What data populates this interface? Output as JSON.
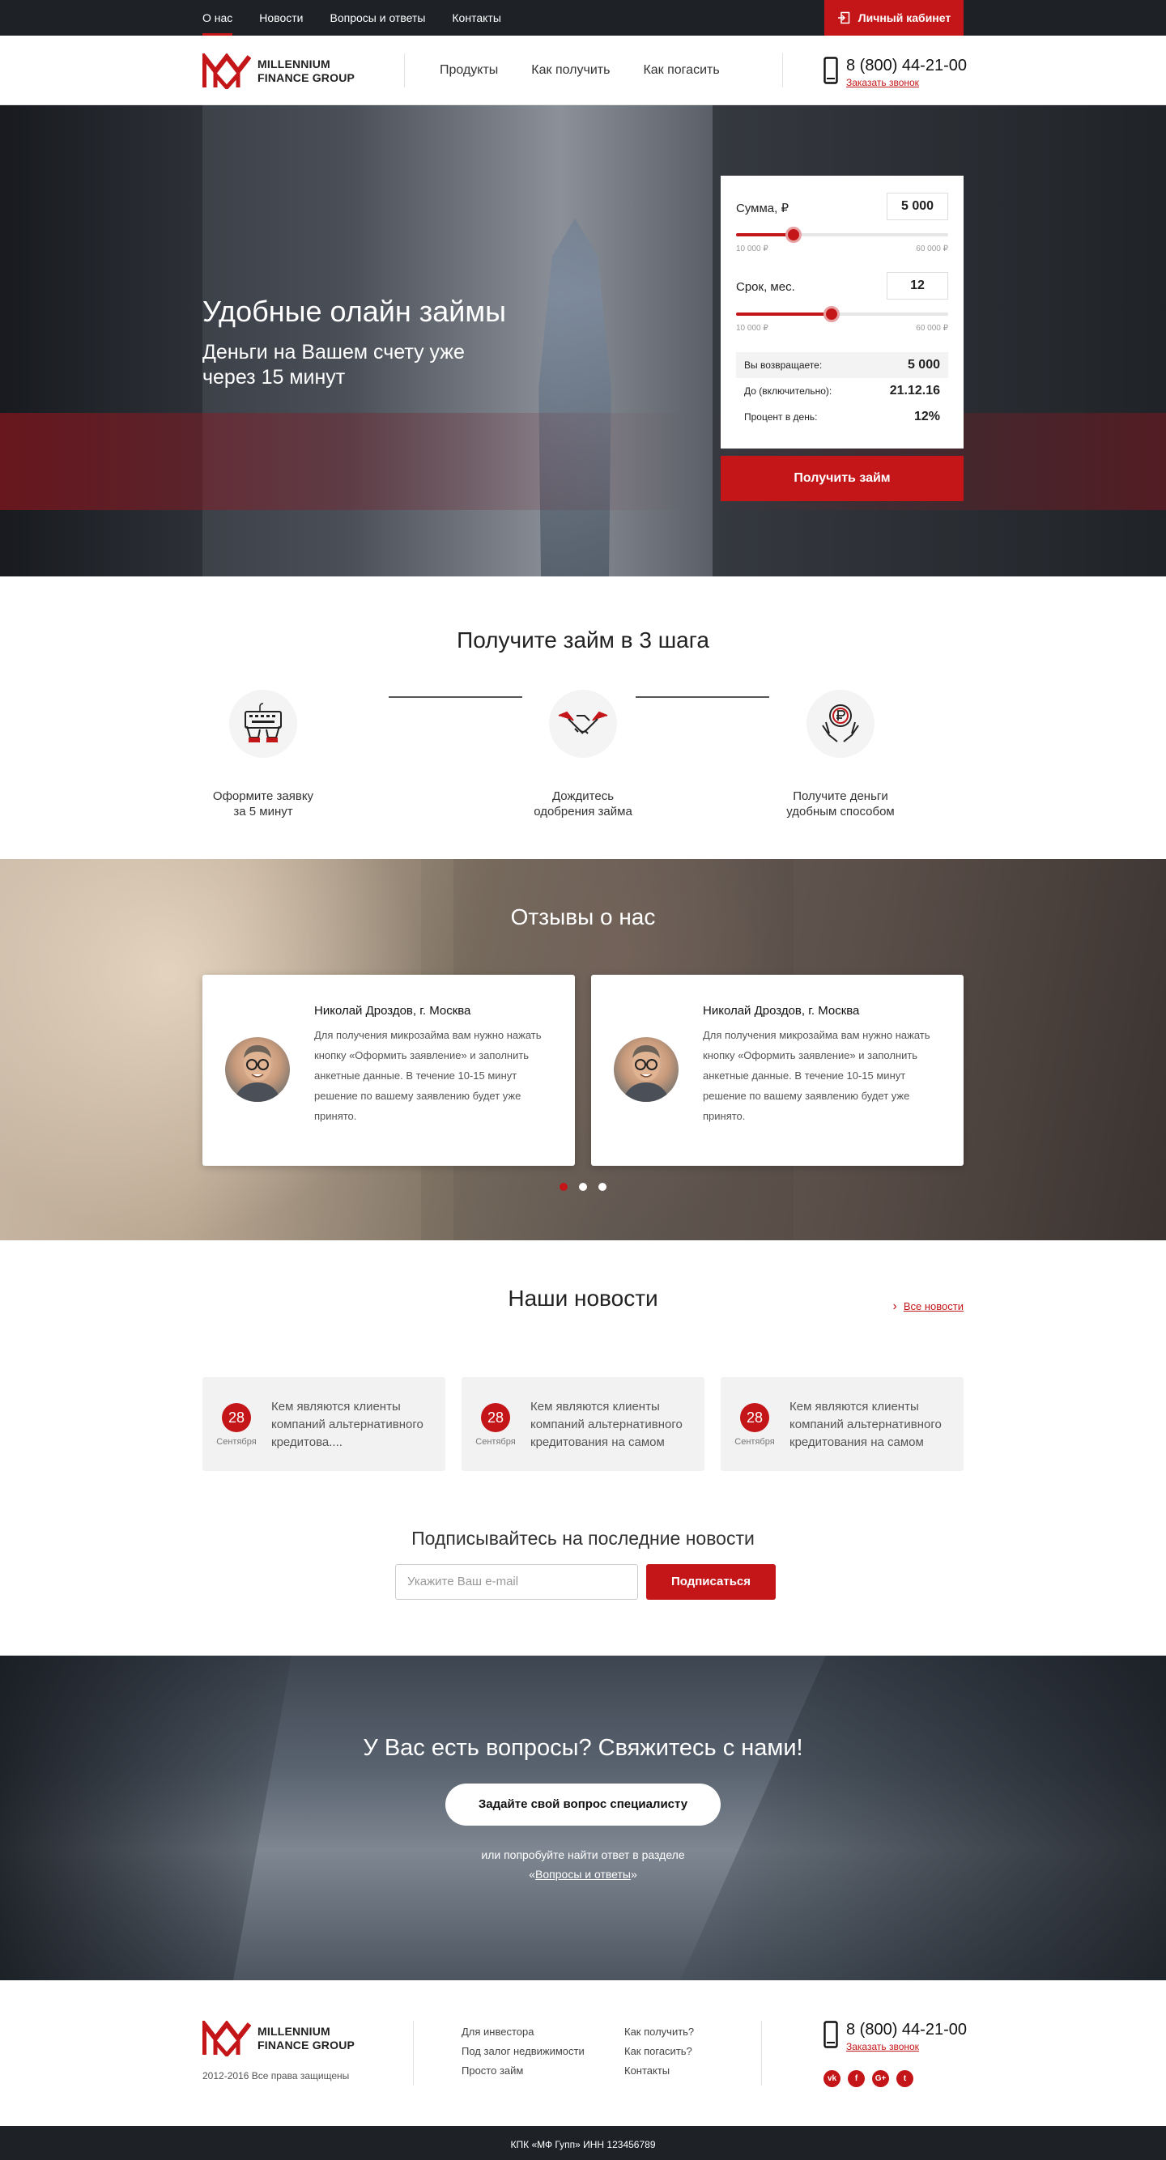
{
  "topbar": {
    "nav": [
      "О нас",
      "Новости",
      "Вопросы и ответы",
      "Контакты"
    ],
    "cabinet": "Личный кабинет"
  },
  "header": {
    "logo_line1": "MILLENNIUM",
    "logo_line2": "FINANCE GROUP",
    "nav": [
      "Продукты",
      "Как получить",
      "Как погасить"
    ],
    "phone": "8 (800) 44-21-00",
    "callback": "Заказать звонок"
  },
  "hero": {
    "title": "Удобные олайн займы",
    "subtitle": "Деньги на Вашем счету уже через 15 минут",
    "calc": {
      "amount_label": "Сумма, ₽",
      "amount_value": "5 000",
      "amount_fill": 0.27,
      "amount_min": "10 000 ₽",
      "amount_max": "60 000 ₽",
      "term_label": "Срок, мес.",
      "term_value": "12",
      "term_fill": 0.45,
      "term_min": "10 000 ₽",
      "term_max": "60 000 ₽",
      "return_label": "Вы возвращаете:",
      "return_value": "5 000",
      "until_label": "До (включительно):",
      "until_value": "21.12.16",
      "rate_label": "Процент в день:",
      "rate_value": "12%"
    },
    "button": "Получить займ"
  },
  "steps": {
    "title": "Получите займ в 3 шага",
    "items": [
      {
        "line1": "Оформите заявку",
        "line2": "за 5 минут"
      },
      {
        "line1": "Дождитесь",
        "line2": "одобрения займа"
      },
      {
        "line1": "Получите деньги",
        "line2": "удобным способом"
      }
    ]
  },
  "reviews": {
    "title": "Отзывы о нас",
    "items": [
      {
        "name": "Николай Дроздов, г. Москва",
        "text": "Для получения микрозайма вам нужно нажать кнопку «Оформить заявление» и заполнить анкетные данные. В течение 10-15 минут решение по вашему заявлению будет уже принято."
      },
      {
        "name": "Николай Дроздов, г. Москва",
        "text": "Для получения микрозайма вам нужно нажать кнопку «Оформить заявление» и заполнить анкетные данные. В течение 10-15 минут решение по вашему заявлению будет уже принято."
      }
    ]
  },
  "news": {
    "title": "Наши новости",
    "all": "Все новости",
    "items": [
      {
        "day": "28",
        "month": "Сентября",
        "text": "Кем являются клиенты компаний альтернативного кредитова...."
      },
      {
        "day": "28",
        "month": "Сентября",
        "text": "Кем являются клиенты компаний альтернативного кредитования на самом"
      },
      {
        "day": "28",
        "month": "Сентября",
        "text": "Кем являются клиенты компаний альтернативного кредитования на самом"
      }
    ],
    "subscribe_title": "Подписывайтесь на последние новости",
    "email_placeholder": "Укажите Ваш e-mail",
    "subscribe_button": "Подписаться"
  },
  "contact": {
    "title": "У Вас есть вопросы? Свяжитесь с нами!",
    "button": "Задайте свой вопрос специалисту",
    "small1": "или попробуйте найти ответ в разделе",
    "small2_prefix": "«",
    "small2_link": "Вопросы и ответы",
    "small2_suffix": "»"
  },
  "footer": {
    "copyright": "2012-2016 Все права защищены",
    "col1": [
      "Для инвестора",
      "Под залог недвижимости",
      "Просто займ"
    ],
    "col2": [
      "Как получить?",
      "Как погасить?",
      "Контакты"
    ],
    "phone": "8 (800) 44-21-00",
    "callback": "Заказать звонок",
    "socials": [
      "vk",
      "f",
      "G+",
      "t"
    ],
    "bottom": "КПК «МФ Гупп» ИНН 123456789"
  },
  "colors": {
    "accent": "#c41618",
    "dark": "#1e2227"
  }
}
